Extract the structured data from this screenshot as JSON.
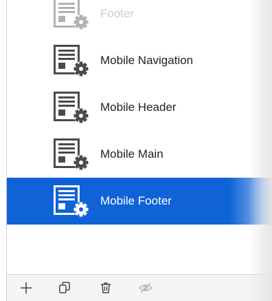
{
  "layouts": [
    {
      "label": "Footer",
      "icon": "layout-settings-icon",
      "state": "partial"
    },
    {
      "label": "Mobile Navigation",
      "icon": "layout-settings-icon",
      "state": "normal"
    },
    {
      "label": "Mobile Header",
      "icon": "layout-settings-icon",
      "state": "normal"
    },
    {
      "label": "Mobile Main",
      "icon": "layout-settings-icon",
      "state": "normal"
    },
    {
      "label": "Mobile Footer",
      "icon": "layout-settings-icon",
      "state": "selected"
    }
  ],
  "toolbar": {
    "buttons": [
      {
        "icon": "plus-icon"
      },
      {
        "icon": "duplicate-icon"
      },
      {
        "icon": "trash-icon"
      },
      {
        "icon": "hide-icon"
      }
    ]
  },
  "colors": {
    "selection": "#0f63d6",
    "icon": "#4a4a4a",
    "text": "#222222"
  }
}
